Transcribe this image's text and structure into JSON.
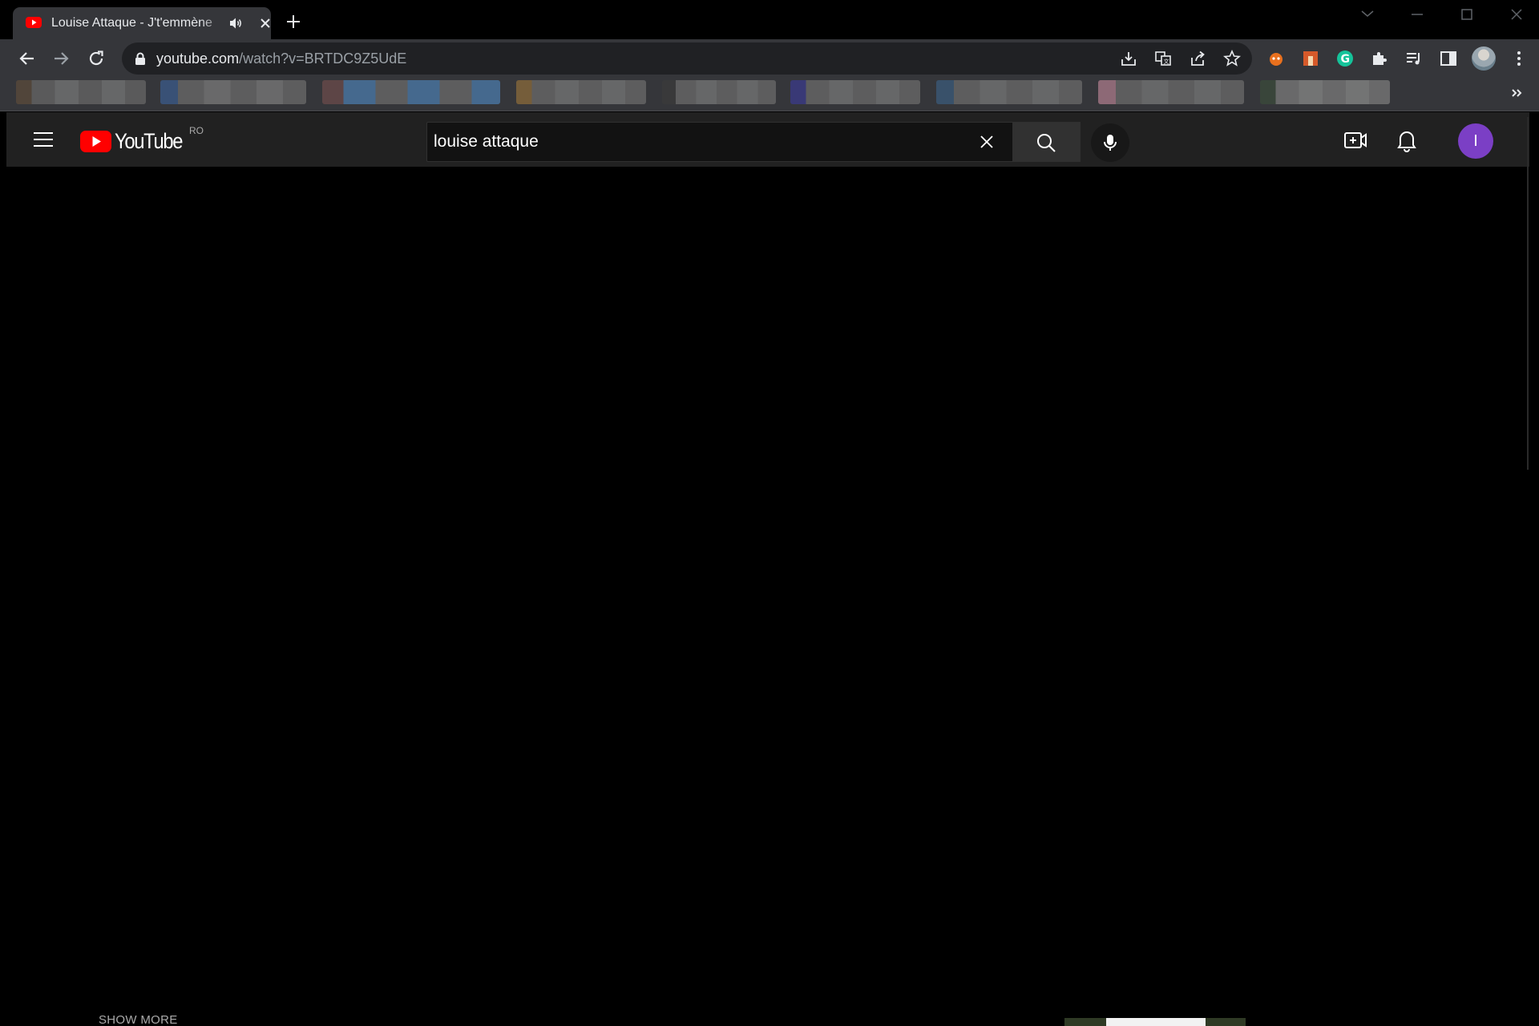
{
  "browser": {
    "tab": {
      "title": "Louise Attaque - J't'emmène"
    },
    "url": {
      "domain": "youtube.com",
      "path": "/watch?v=BRTDC9Z5UdE"
    },
    "bookmarks": [
      {
        "name": "bookmark-1",
        "colors": [
          "#5a4a3a",
          "#666666",
          "#777777"
        ]
      },
      {
        "name": "bookmark-2",
        "colors": [
          "#3a5a8a",
          "#6a6a6a",
          "#7a7a7a"
        ]
      },
      {
        "name": "bookmark-3",
        "colors": [
          "#6a4a4a",
          "#4a7aaa",
          "#6a6a6a"
        ]
      },
      {
        "name": "bookmark-4",
        "colors": [
          "#8a6a3a",
          "#6a6a6a",
          "#777777"
        ]
      },
      {
        "name": "bookmark-5",
        "colors": [
          "#3a3a3a",
          "#6a6a6a",
          "#777777"
        ]
      },
      {
        "name": "bookmark-6",
        "colors": [
          "#3a3a8a",
          "#6a6a6a",
          "#777777"
        ]
      },
      {
        "name": "bookmark-7",
        "colors": [
          "#3a5a7a",
          "#6a6a6a",
          "#777777"
        ]
      },
      {
        "name": "bookmark-8",
        "colors": [
          "#aa7a8a",
          "#6a6a6a",
          "#777777"
        ]
      },
      {
        "name": "bookmark-9",
        "colors": [
          "#3a4a3a",
          "#7a7a7a",
          "#888888"
        ]
      }
    ]
  },
  "youtube": {
    "logo_text": "YouTube",
    "country_code": "RO",
    "search": {
      "value": "louise attaque"
    },
    "avatar_letter": "I",
    "below_player": {
      "show_more": "SHOW MORE"
    }
  },
  "colors": {
    "accent_red": "#ff0000",
    "avatar_purple": "#7b3fc5",
    "masthead_bg": "#212121"
  }
}
